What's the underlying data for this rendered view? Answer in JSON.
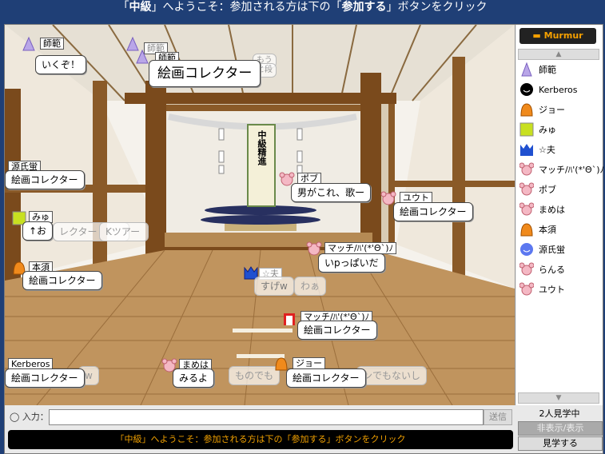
{
  "title": {
    "q1": "「",
    "room": "中級",
    "q2": "」",
    "rest1": "へようこそ：参加される方は下の「",
    "join": "参加する",
    "rest2": "」ボタンをクリック"
  },
  "room": {
    "scroll": "中級精進"
  },
  "bubbles": [
    {
      "name": "師範",
      "msg": "いくぞ！"
    },
    {
      "name": "師範",
      "msg": "絵画コレクター"
    },
    {
      "name": "源氏蛍",
      "msg": "絵画コレクター"
    },
    {
      "name": "みゅ",
      "msg": "↑お"
    },
    {
      "name": "ポブ",
      "msg": "男がこれ、歌ー"
    },
    {
      "name": "ユウト",
      "msg": "絵画コレクター"
    },
    {
      "name": "マッチ/ﾊ'(*'Θ`)ﾉ",
      "msg": "いpっぱいだ"
    },
    {
      "name": "本須",
      "msg": "絵画コレクター"
    },
    {
      "name": "☆夫",
      "msg": "すげw"
    },
    {
      "name": "マッチ/ﾊ'(*'Θ`)ﾉ",
      "msg": "絵画コレクター"
    },
    {
      "name": "Kerberos",
      "msg": "絵画コレクター"
    },
    {
      "name": "まめは",
      "msg": "みるよ"
    },
    {
      "name": "ジョー",
      "msg": "絵画コレクター"
    }
  ],
  "faded": {
    "f1": "レクター",
    "f2": "Kツアー",
    "f3": "わぁ",
    "f4": "ものでも",
    "f5": "ンでもないし",
    "f6": "もう",
    "f7": "と段",
    "f8": "w"
  },
  "sidebar": {
    "logo": "Murmur",
    "users": [
      {
        "name": "師範",
        "icon": "witch-icon",
        "color": "#b9a6e8"
      },
      {
        "name": "Kerberos",
        "icon": "black-smile-icon",
        "color": "#000000"
      },
      {
        "name": "ジョー",
        "icon": "orange-blob-icon",
        "color": "#f08a1c"
      },
      {
        "name": "みゅ",
        "icon": "green-square-icon",
        "color": "#c8e020"
      },
      {
        "name": "☆夫",
        "icon": "blue-crown-icon",
        "color": "#2050d0"
      },
      {
        "name": "マッチ/ﾊ'(*'Θ`)ﾉ",
        "icon": "pink-bear-icon",
        "color": "#f4b8c4"
      },
      {
        "name": "ポブ",
        "icon": "pink-bear-icon",
        "color": "#f4b8c4"
      },
      {
        "name": "まめは",
        "icon": "pink-bear-icon",
        "color": "#f4b8c4"
      },
      {
        "name": "本須",
        "icon": "orange-blob-icon",
        "color": "#f08a1c"
      },
      {
        "name": "源氏蛍",
        "icon": "blue-smile-icon",
        "color": "#5c78f0"
      },
      {
        "name": "らんる",
        "icon": "pink-bear-icon",
        "color": "#f4b8c4"
      },
      {
        "name": "ユウト",
        "icon": "pink-bear-icon",
        "color": "#f4b8c4"
      }
    ]
  },
  "input": {
    "label": "入力：",
    "value": "",
    "send": "送信"
  },
  "ticker": "「中級」へようこそ：参加される方は下の「参加する」ボタンをクリック",
  "spectators": "2人見学中",
  "toggle": "非表示/表示",
  "watch": "見学する"
}
